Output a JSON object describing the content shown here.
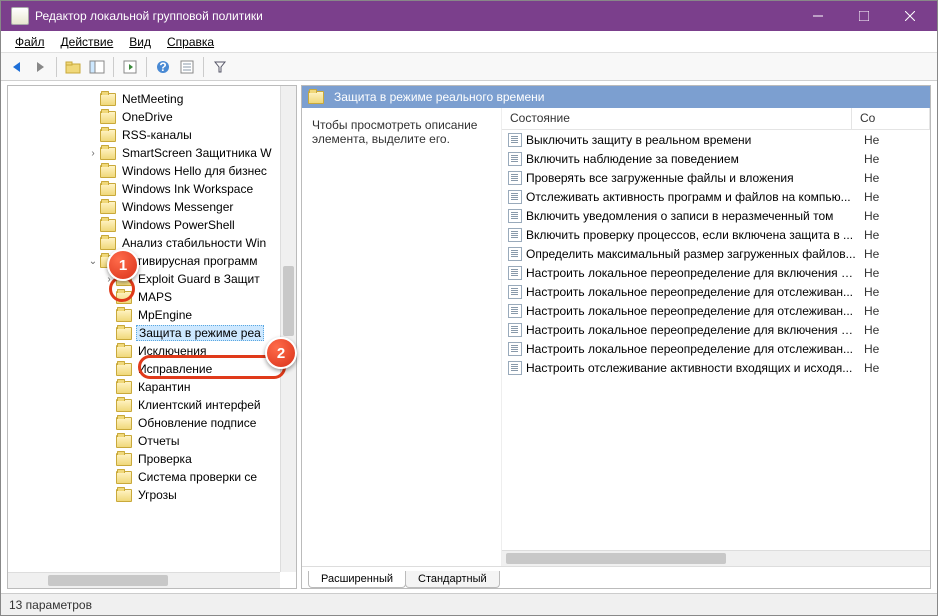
{
  "window": {
    "title": "Редактор локальной групповой политики"
  },
  "menu": {
    "file": "Файл",
    "action": "Действие",
    "view": "Вид",
    "help": "Справка"
  },
  "tree": [
    {
      "indent": 3,
      "exp": "",
      "label": "NetMeeting"
    },
    {
      "indent": 3,
      "exp": "",
      "label": "OneDrive"
    },
    {
      "indent": 3,
      "exp": "",
      "label": "RSS-каналы"
    },
    {
      "indent": 3,
      "exp": ">",
      "label": "SmartScreen Защитника W"
    },
    {
      "indent": 3,
      "exp": "",
      "label": "Windows Hello для бизнес"
    },
    {
      "indent": 3,
      "exp": "",
      "label": "Windows Ink Workspace"
    },
    {
      "indent": 3,
      "exp": "",
      "label": "Windows Messenger"
    },
    {
      "indent": 3,
      "exp": "",
      "label": "Windows PowerShell"
    },
    {
      "indent": 3,
      "exp": "",
      "label": "Анализ стабильности Win"
    },
    {
      "indent": 3,
      "exp": "v",
      "label": "Антивирусная программ"
    },
    {
      "indent": 4,
      "exp": ">",
      "label": "Exploit Guard в Защит"
    },
    {
      "indent": 4,
      "exp": "",
      "label": "MAPS"
    },
    {
      "indent": 4,
      "exp": "",
      "label": "MpEngine"
    },
    {
      "indent": 4,
      "exp": "",
      "label": "Защита в режиме реа",
      "sel": true
    },
    {
      "indent": 4,
      "exp": "",
      "label": "Исключения"
    },
    {
      "indent": 4,
      "exp": "",
      "label": "Исправление"
    },
    {
      "indent": 4,
      "exp": "",
      "label": "Карантин"
    },
    {
      "indent": 4,
      "exp": "",
      "label": "Клиентский интерфей"
    },
    {
      "indent": 4,
      "exp": "",
      "label": "Обновление подписе"
    },
    {
      "indent": 4,
      "exp": "",
      "label": "Отчеты"
    },
    {
      "indent": 4,
      "exp": "",
      "label": "Проверка"
    },
    {
      "indent": 4,
      "exp": "",
      "label": "Система проверки се"
    },
    {
      "indent": 4,
      "exp": "",
      "label": "Угрозы"
    }
  ],
  "right": {
    "header": "Защита в режиме реального времени",
    "desc": "Чтобы просмотреть описание элемента, выделите его.",
    "cols": {
      "c1": "Состояние",
      "c2": "Со"
    },
    "rows": [
      {
        "t": "Выключить защиту в реальном времени",
        "s": "Не"
      },
      {
        "t": "Включить наблюдение за поведением",
        "s": "Не"
      },
      {
        "t": "Проверять все загруженные файлы и вложения",
        "s": "Не"
      },
      {
        "t": "Отслеживать активность программ и файлов на компью...",
        "s": "Не"
      },
      {
        "t": "Включить уведомления о записи в неразмеченный том",
        "s": "Не"
      },
      {
        "t": "Включить проверку процессов, если включена защита в ...",
        "s": "Не"
      },
      {
        "t": "Определить максимальный размер загруженных файлов...",
        "s": "Не"
      },
      {
        "t": "Настроить локальное переопределение для включения к...",
        "s": "Не"
      },
      {
        "t": "Настроить локальное переопределение для отслеживан...",
        "s": "Не"
      },
      {
        "t": "Настроить локальное переопределение для отслеживан...",
        "s": "Не"
      },
      {
        "t": "Настроить локальное переопределение для включения з...",
        "s": "Не"
      },
      {
        "t": "Настроить локальное переопределение для отслеживан...",
        "s": "Не"
      },
      {
        "t": "Настроить отслеживание активности входящих и исходя...",
        "s": "Не"
      }
    ]
  },
  "tabs": {
    "ext": "Расширенный",
    "std": "Стандартный"
  },
  "status": "13 параметров",
  "callouts": {
    "c1": "1",
    "c2": "2"
  }
}
